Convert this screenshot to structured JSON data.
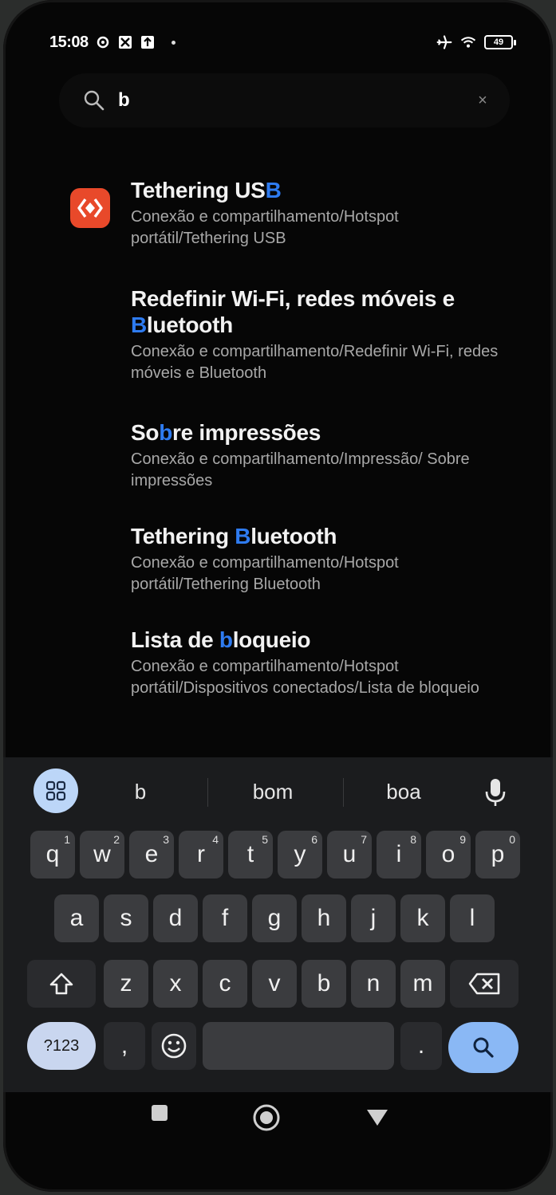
{
  "status": {
    "time": "15:08",
    "battery": "49"
  },
  "search": {
    "query": "b",
    "clear": "×"
  },
  "results": [
    {
      "title_pre": "Tethering US",
      "title_hl": "B",
      "title_post": "",
      "path": "Conexão e compartilhamento/Hotspot portátil/Tethering USB"
    },
    {
      "title_pre": "Redefinir Wi-Fi, redes móveis e ",
      "title_hl": "B",
      "title_post": "luetooth",
      "path": "Conexão e compartilhamento/Redefinir Wi-Fi, redes móveis e Bluetooth"
    },
    {
      "title_pre": "So",
      "title_hl": "b",
      "title_post": "re impressões",
      "path": "Conexão e compartilhamento/Impressão/ Sobre impressões"
    },
    {
      "title_pre": "Tethering ",
      "title_hl": "B",
      "title_post": "luetooth",
      "path": "Conexão e compartilhamento/Hotspot portátil/Tethering Bluetooth"
    },
    {
      "title_pre": "Lista de ",
      "title_hl": "b",
      "title_post": "loqueio",
      "path": "Conexão e compartilhamento/Hotspot portátil/Dispositivos conectados/Lista de bloqueio"
    }
  ],
  "keyboard": {
    "suggestions": [
      "b",
      "bom",
      "boa"
    ],
    "row1": [
      "q",
      "w",
      "e",
      "r",
      "t",
      "y",
      "u",
      "i",
      "o",
      "p"
    ],
    "row1_hints": [
      "1",
      "2",
      "3",
      "4",
      "5",
      "6",
      "7",
      "8",
      "9",
      "0"
    ],
    "row2": [
      "a",
      "s",
      "d",
      "f",
      "g",
      "h",
      "j",
      "k",
      "l"
    ],
    "row3": [
      "z",
      "x",
      "c",
      "v",
      "b",
      "n",
      "m"
    ],
    "symbols_label": "?123",
    "comma": ",",
    "period": "."
  },
  "icons": {
    "app": "hotspot-icon",
    "search": "search-icon",
    "mic": "microphone-icon",
    "shift": "shift-icon",
    "backspace": "backspace-icon",
    "emoji": "emoji-icon",
    "go": "search-key-icon",
    "nav": [
      "recents-icon",
      "home-icon",
      "back-icon"
    ]
  },
  "colors": {
    "highlight": "#2e7bf0",
    "app_icon": "#e8492a",
    "accent_key": "#8ab8f5"
  }
}
